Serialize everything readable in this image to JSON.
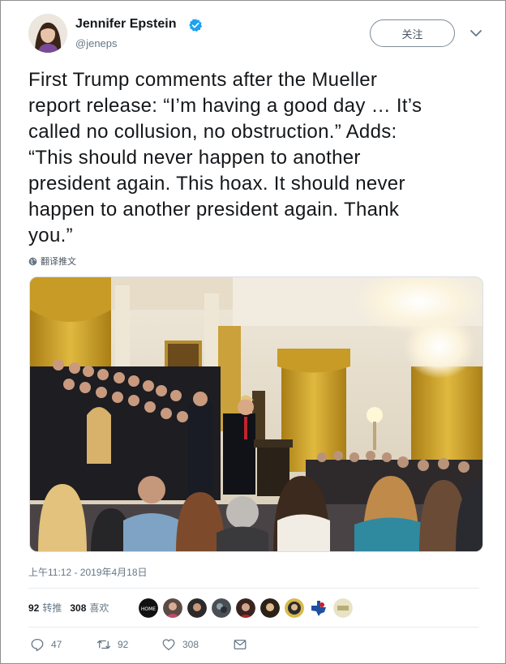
{
  "user": {
    "name": "Jennifer Epstein",
    "handle": "@jeneps",
    "verified": true
  },
  "follow_label": "关注",
  "tweet_text": "First Trump comments after the Mueller\nreport release: “I’m having a good day … It’s\ncalled no collusion, no obstruction.” Adds:\n“This should never happen to another\npresident again. This hoax. It should never\nhappen to another president again. Thank\nyou.”",
  "translate_label": "翻译推文",
  "timestamp": "上午11:12 - 2019年4月18日",
  "stats": {
    "retweets_count": "92",
    "retweets_label": "转推",
    "likes_count": "308",
    "likes_label": "喜欢"
  },
  "liker_avatars": [
    "avatar-1",
    "avatar-2",
    "avatar-3",
    "avatar-4",
    "avatar-5",
    "avatar-6",
    "avatar-7",
    "avatar-8",
    "avatar-9"
  ],
  "actions": {
    "replies": "47",
    "retweets": "92",
    "likes": "308"
  },
  "colors": {
    "verified_blue": "#1da1f2",
    "secondary_text": "#657786",
    "text": "#14171a"
  },
  "icons": [
    "verified-badge-icon",
    "chevron-down-icon",
    "globe-icon",
    "reply-icon",
    "retweet-icon",
    "like-icon",
    "message-icon"
  ]
}
